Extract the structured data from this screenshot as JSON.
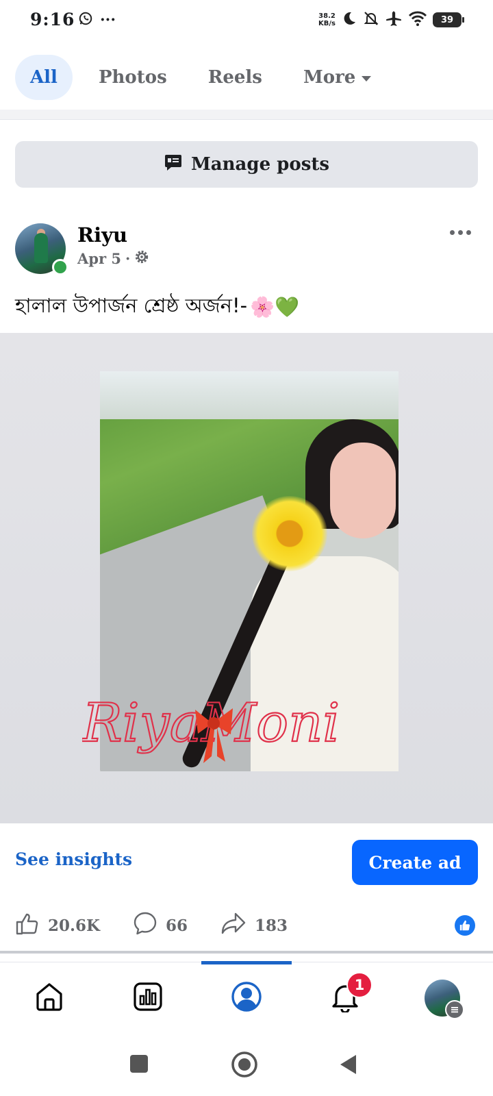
{
  "status_bar": {
    "time": "9:16",
    "dots": "···",
    "net_speed_value": "38.2",
    "net_speed_unit": "KB/s",
    "battery": "39",
    "icons": [
      "whatsapp-icon",
      "moon-icon",
      "bell-off-icon",
      "airplane-icon",
      "wifi-icon",
      "battery-icon"
    ]
  },
  "tabs": [
    {
      "label": "All",
      "active": true
    },
    {
      "label": "Photos",
      "active": false
    },
    {
      "label": "Reels",
      "active": false
    },
    {
      "label": "More",
      "active": false
    }
  ],
  "manage_posts": {
    "label": "Manage posts"
  },
  "post": {
    "author": "Riyu",
    "date": "Apr 5",
    "separator": "·",
    "caption": "হালাল উপার্জন শ্রেষ্ঠ অর্জন!-",
    "caption_emojis": "🌸💚",
    "image_watermark": "RiyaMoni",
    "insights_label": "See insights",
    "create_ad_label": "Create ad",
    "likes": "20.6K",
    "comments": "66",
    "shares": "183"
  },
  "bottom_nav": {
    "items": [
      "home",
      "dashboard",
      "profile",
      "notifications",
      "menu"
    ],
    "active": "profile",
    "notification_count": "1"
  },
  "colors": {
    "accent": "#1b64c7",
    "button_blue": "#0866ff",
    "badge_red": "#e41e3f",
    "online_green": "#31a24c"
  }
}
